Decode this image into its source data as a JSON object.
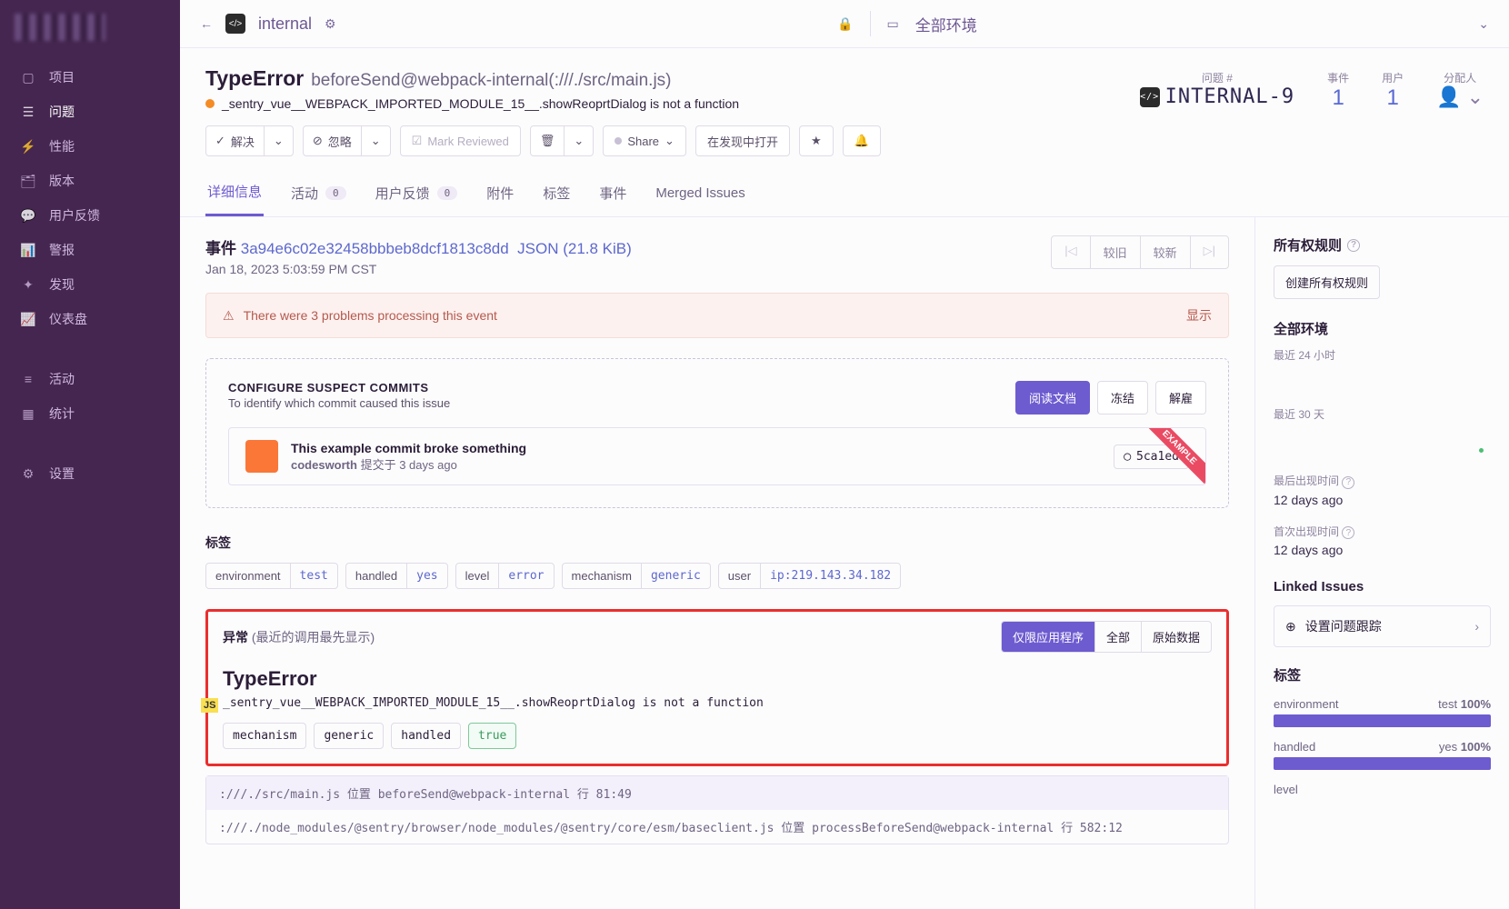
{
  "sidebar": {
    "items": [
      {
        "icon": "▢",
        "label": "项目"
      },
      {
        "icon": "☰",
        "label": "问题",
        "active": true
      },
      {
        "icon": "⚡",
        "label": "性能"
      },
      {
        "icon": "🗂",
        "label": "版本"
      },
      {
        "icon": "💬",
        "label": "用户反馈"
      },
      {
        "icon": "📊",
        "label": "警报"
      },
      {
        "icon": "✦",
        "label": "发现"
      },
      {
        "icon": "📈",
        "label": "仪表盘"
      }
    ],
    "items2": [
      {
        "icon": "≡",
        "label": "活动"
      },
      {
        "icon": "▦",
        "label": "统计"
      }
    ],
    "items3": [
      {
        "icon": "⚙",
        "label": "设置"
      }
    ]
  },
  "topbar": {
    "project": "internal",
    "env": "全部环境"
  },
  "issue": {
    "type": "TypeError",
    "location": "beforeSend@webpack-internal(:///./src/main.js)",
    "msg": "_sentry_vue__WEBPACK_IMPORTED_MODULE_15__.showReoprtDialog is not a function",
    "idLabel": "问题 #",
    "id": "INTERNAL-9",
    "eventsLabel": "事件",
    "events": "1",
    "usersLabel": "用户",
    "users": "1",
    "assignLabel": "分配人"
  },
  "btns": {
    "resolve": "解决",
    "ignore": "忽略",
    "mark": "Mark Reviewed",
    "share": "Share",
    "open": "在发现中打开"
  },
  "tabs": {
    "details": "详细信息",
    "activity": "活动",
    "activityCount": "0",
    "feedback": "用户反馈",
    "feedbackCount": "0",
    "attach": "附件",
    "tags": "标签",
    "events": "事件",
    "merged": "Merged Issues"
  },
  "event": {
    "label": "事件",
    "id": "3a94e6c02e32458bbbeb8dcf1813c8dd",
    "json": "JSON (21.8 KiB)",
    "time": "Jan 18, 2023 5:03:59 PM CST",
    "nav": {
      "first": "|◁",
      "older": "较旧",
      "newer": "较新",
      "last": "▷|"
    },
    "warning": "There were 3 problems processing this event",
    "show": "显示"
  },
  "suspect": {
    "h": "CONFIGURE SUSPECT COMMITS",
    "sub": "To identify which commit caused this issue",
    "doc": "阅读文档",
    "freeze": "冻结",
    "remove": "解雇",
    "commitTitle": "This example commit broke something",
    "author": "codesworth",
    "rel": "提交于 3 days ago",
    "hash": "5ca1ed",
    "ribbon": "EXAMPLE"
  },
  "tagsec": {
    "title": "标签"
  },
  "tags": [
    {
      "k": "environment",
      "v": "test"
    },
    {
      "k": "handled",
      "v": "yes"
    },
    {
      "k": "level",
      "v": "error"
    },
    {
      "k": "mechanism",
      "v": "generic"
    },
    {
      "k": "user",
      "v": "ip:219.143.34.182"
    }
  ],
  "exc": {
    "title": "异常",
    "subtitle": "(最近的调用最先显示)",
    "btn1": "仅限应用程序",
    "btn2": "全部",
    "btn3": "原始数据",
    "type": "TypeError",
    "msg": "_sentry_vue__WEBPACK_IMPORTED_MODULE_15__.showReoprtDialog is not a function",
    "mech": [
      {
        "t": "mechanism"
      },
      {
        "t": "generic"
      },
      {
        "t": "handled"
      },
      {
        "t": "true",
        "green": true
      }
    ],
    "frames": [
      ":///./src/main.js 位置 beforeSend@webpack-internal 行 81:49",
      ":///./node_modules/@sentry/browser/node_modules/@sentry/core/esm/baseclient.js 位置 processBeforeSend@webpack-internal 行 582:12"
    ]
  },
  "rs": {
    "ownership": "所有权规则",
    "createRule": "创建所有权规则",
    "allenv": "全部环境",
    "last24": "最近 24 小时",
    "last30": "最近 30 天",
    "lastSeen": "最后出现时间",
    "lastSeenVal": "12 days ago",
    "firstSeen": "首次出现时间",
    "firstSeenVal": "12 days ago",
    "linked": "Linked Issues",
    "setTracking": "设置问题跟踪",
    "tagsH": "标签",
    "tagLines": [
      {
        "name": "environment",
        "val": "test",
        "pct": "100%"
      },
      {
        "name": "handled",
        "val": "yes",
        "pct": "100%"
      },
      {
        "name": "level",
        "val": "",
        "pct": ""
      }
    ]
  }
}
